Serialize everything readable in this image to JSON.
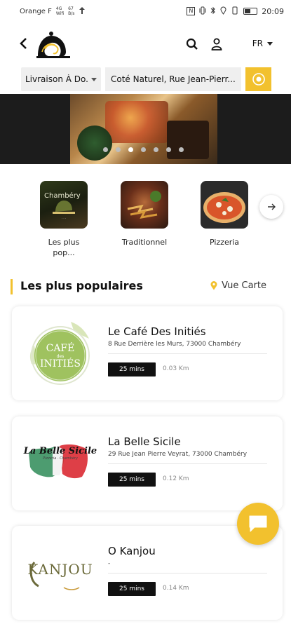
{
  "status_bar": {
    "carrier": "Orange F",
    "network_tiny_top": "4G",
    "network_tiny_bottom": "Wifi",
    "speed_top": "67",
    "speed_bottom": "B/s",
    "nfc_label": "N",
    "time": "20:09",
    "battery_level": 0.5
  },
  "header": {
    "language": "FR"
  },
  "search": {
    "delivery_mode": "Livraison À Do...",
    "address": "Coté Naturel, Rue Jean-Pierr..."
  },
  "banner": {
    "slide_count": 7,
    "active_slide": 2
  },
  "categories": [
    {
      "name": "Les plus pop...",
      "image_text": "Chambéry"
    },
    {
      "name": "Traditionnel",
      "image_text": ""
    },
    {
      "name": "Pizzeria",
      "image_text": ""
    }
  ],
  "section": {
    "title": "Les plus populaires",
    "map_link": "Vue Carte"
  },
  "restaurants": [
    {
      "name": "Le Café Des Initiés",
      "address": "8 Rue Derrière les Murs, 73000 Chambéry",
      "time": "25 mins",
      "distance": "0.03 Km",
      "logo_text_1": "CAFÉ",
      "logo_text_2": "INITIÉS",
      "logo_small": "des"
    },
    {
      "name": "La Belle Sicile",
      "address": "29 Rue Jean Pierre Veyrat, 73000 Chambéry",
      "time": "25 mins",
      "distance": "0.12 Km",
      "logo_text_1": "La Belle Sicile",
      "logo_small": "Pizzeria · Chambéry"
    },
    {
      "name": "O Kanjou",
      "address": "-",
      "time": "25 mins",
      "distance": "0.14 Km",
      "logo_text_1": "KANJOU"
    }
  ],
  "colors": {
    "accent": "#f2c12e",
    "badge": "#111111",
    "cafe_green": "#9fc25f",
    "sicile_red": "#d9242e",
    "kanjou_olive": "#6b6a3a"
  }
}
